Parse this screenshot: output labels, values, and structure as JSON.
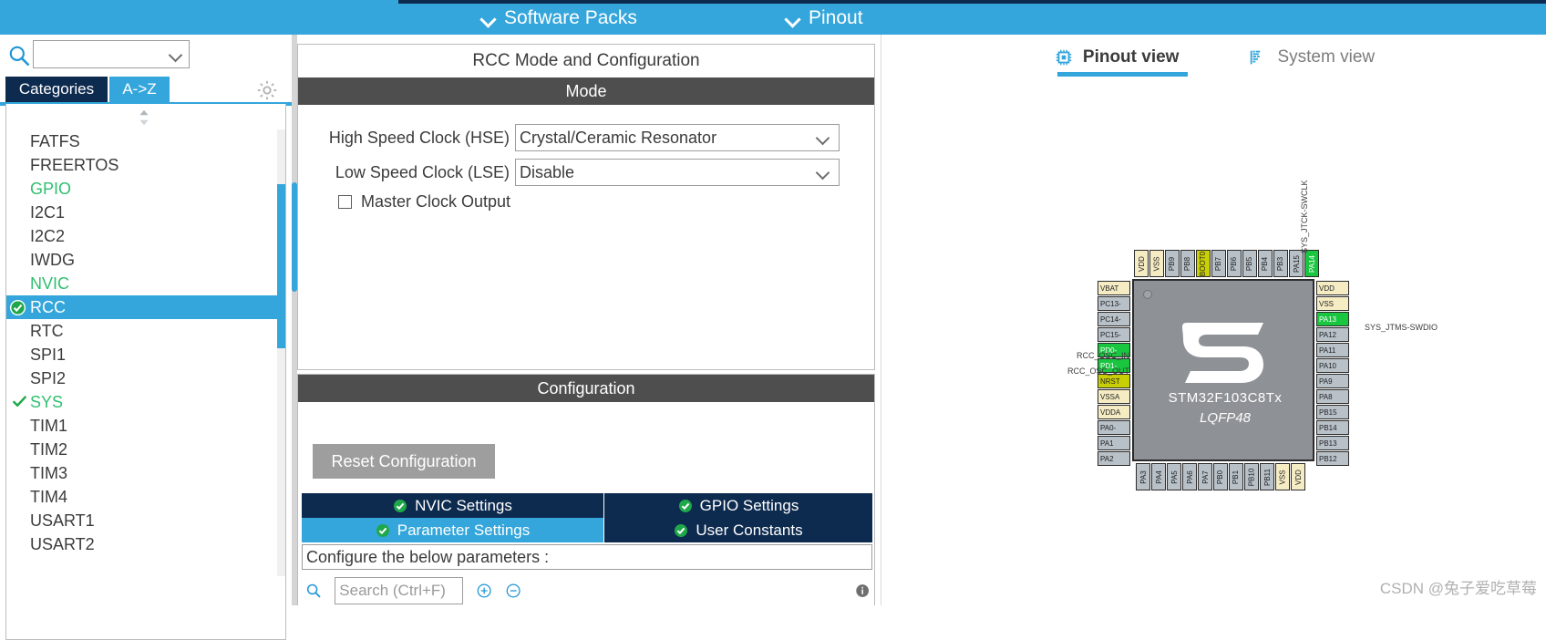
{
  "topbar": {
    "software_packs_label": "Software Packs",
    "pinout_label": "Pinout",
    "accent_color": "#34a6db",
    "dark_color": "#0d2a4f"
  },
  "sidebar": {
    "search_value": "",
    "search_placeholder": "",
    "tabs": [
      {
        "label": "Categories",
        "active": false
      },
      {
        "label": "A->Z",
        "active": true
      }
    ],
    "items": [
      {
        "label": "FATFS",
        "state": "none"
      },
      {
        "label": "FREERTOS",
        "state": "none"
      },
      {
        "label": "GPIO",
        "state": "green"
      },
      {
        "label": "I2C1",
        "state": "none"
      },
      {
        "label": "I2C2",
        "state": "none"
      },
      {
        "label": "IWDG",
        "state": "none"
      },
      {
        "label": "NVIC",
        "state": "green"
      },
      {
        "label": "RCC",
        "state": "selected"
      },
      {
        "label": "RTC",
        "state": "none"
      },
      {
        "label": "SPI1",
        "state": "none"
      },
      {
        "label": "SPI2",
        "state": "none"
      },
      {
        "label": "SYS",
        "state": "checked"
      },
      {
        "label": "TIM1",
        "state": "none"
      },
      {
        "label": "TIM2",
        "state": "none"
      },
      {
        "label": "TIM3",
        "state": "none"
      },
      {
        "label": "TIM4",
        "state": "none"
      },
      {
        "label": "USART1",
        "state": "none"
      },
      {
        "label": "USART2",
        "state": "none"
      }
    ]
  },
  "mode_panel": {
    "title": "RCC Mode and Configuration",
    "section_label": "Mode",
    "rows": [
      {
        "label": "High Speed Clock (HSE)",
        "value": "Crystal/Ceramic Resonator"
      },
      {
        "label": "Low Speed Clock (LSE)",
        "value": "Disable"
      }
    ],
    "checkbox_label": "Master Clock Output",
    "checkbox_checked": false
  },
  "config_panel": {
    "section_label": "Configuration",
    "reset_label": "Reset Configuration",
    "tabs_row1": [
      {
        "label": "NVIC Settings",
        "active": false
      },
      {
        "label": "GPIO Settings",
        "active": false
      }
    ],
    "tabs_row2": [
      {
        "label": "Parameter Settings",
        "active": true
      },
      {
        "label": "User Constants",
        "active": false
      }
    ],
    "hint": "Configure the below parameters :",
    "search_placeholder": "Search (Ctrl+F)"
  },
  "right_panel": {
    "tabs": [
      {
        "label": "Pinout view",
        "icon": "chip-icon",
        "active": true
      },
      {
        "label": "System view",
        "icon": "bars-icon",
        "active": false
      }
    ]
  },
  "chip": {
    "name": "STM32F103C8Tx",
    "package": "LQFP48",
    "top_pins": [
      {
        "label": "VDD",
        "kind": "power"
      },
      {
        "label": "VSS",
        "kind": "power"
      },
      {
        "label": "PB9",
        "kind": "normal"
      },
      {
        "label": "PB8",
        "kind": "normal"
      },
      {
        "label": "BOOT0",
        "kind": "boot"
      },
      {
        "label": "PB7",
        "kind": "normal"
      },
      {
        "label": "PB6",
        "kind": "normal"
      },
      {
        "label": "PB5",
        "kind": "normal"
      },
      {
        "label": "PB4",
        "kind": "normal"
      },
      {
        "label": "PB3",
        "kind": "normal"
      },
      {
        "label": "PA15",
        "kind": "normal"
      },
      {
        "label": "PA14",
        "kind": "used"
      }
    ],
    "left_pins": [
      {
        "label": "VBAT",
        "kind": "power"
      },
      {
        "label": "PC13-",
        "kind": "normal"
      },
      {
        "label": "PC14-",
        "kind": "normal"
      },
      {
        "label": "PC15-",
        "kind": "normal"
      },
      {
        "label": "PD0-",
        "kind": "used"
      },
      {
        "label": "PD1-",
        "kind": "used"
      },
      {
        "label": "NRST",
        "kind": "boot"
      },
      {
        "label": "VSSA",
        "kind": "power"
      },
      {
        "label": "VDDA",
        "kind": "power"
      },
      {
        "label": "PA0-",
        "kind": "normal"
      },
      {
        "label": "PA1",
        "kind": "normal"
      },
      {
        "label": "PA2",
        "kind": "normal"
      }
    ],
    "right_pins": [
      {
        "label": "VDD",
        "kind": "power"
      },
      {
        "label": "VSS",
        "kind": "power"
      },
      {
        "label": "PA13",
        "kind": "used"
      },
      {
        "label": "PA12",
        "kind": "normal"
      },
      {
        "label": "PA11",
        "kind": "normal"
      },
      {
        "label": "PA10",
        "kind": "normal"
      },
      {
        "label": "PA9",
        "kind": "normal"
      },
      {
        "label": "PA8",
        "kind": "normal"
      },
      {
        "label": "PB15",
        "kind": "normal"
      },
      {
        "label": "PB14",
        "kind": "normal"
      },
      {
        "label": "PB13",
        "kind": "normal"
      },
      {
        "label": "PB12",
        "kind": "normal"
      }
    ],
    "bottom_pins": [
      {
        "label": "PA3",
        "kind": "normal"
      },
      {
        "label": "PA4",
        "kind": "normal"
      },
      {
        "label": "PA5",
        "kind": "normal"
      },
      {
        "label": "PA6",
        "kind": "normal"
      },
      {
        "label": "PA7",
        "kind": "normal"
      },
      {
        "label": "PB0",
        "kind": "normal"
      },
      {
        "label": "PB1",
        "kind": "normal"
      },
      {
        "label": "PB10",
        "kind": "normal"
      },
      {
        "label": "PB11",
        "kind": "normal"
      },
      {
        "label": "VSS",
        "kind": "power"
      },
      {
        "label": "VDD",
        "kind": "power"
      }
    ],
    "signals": {
      "osc_in": "RCC_OSC_IN",
      "osc_out": "RCC_OSC_OUT",
      "jtms": "SYS_JTMS-SWDIO",
      "jtck": "SYS_JTCK-SWCLK"
    }
  },
  "watermark": "CSDN @兔子爱吃草莓"
}
